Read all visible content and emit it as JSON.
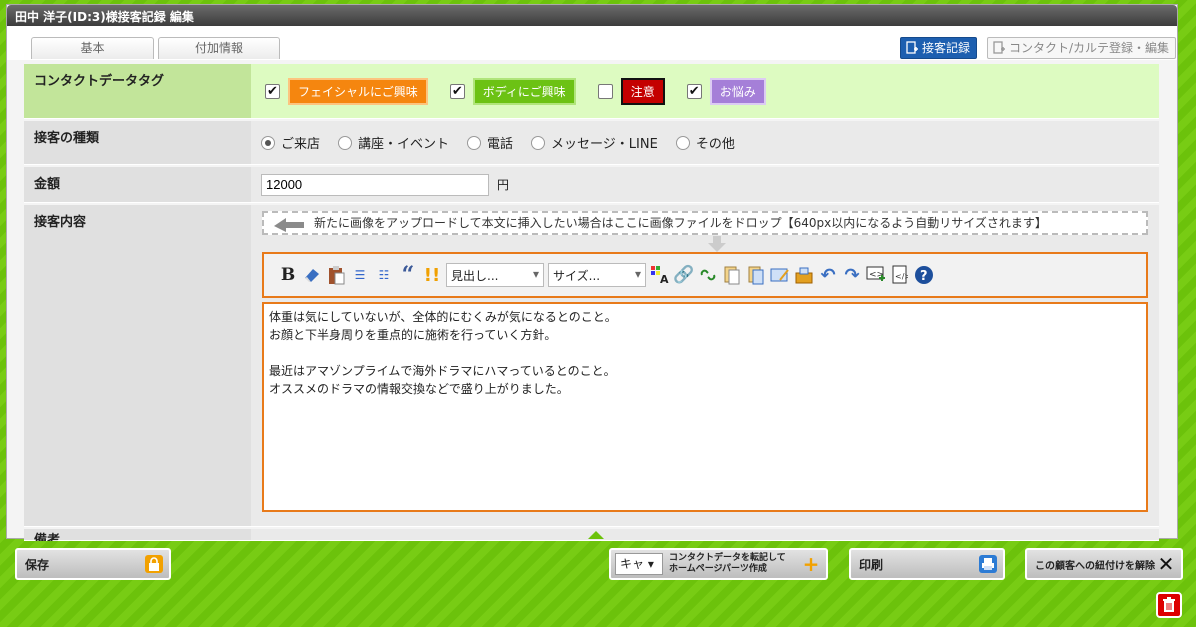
{
  "window": {
    "title": "田中 洋子(ID:3)様接客記録 編集"
  },
  "tabs": [
    {
      "label": "基本"
    },
    {
      "label": "付加情報"
    }
  ],
  "right_tabs": [
    {
      "label": "接客記録"
    },
    {
      "label": "コンタクト/カルテ登録・編集"
    }
  ],
  "tags": {
    "label": "コンタクトデータタグ",
    "items": [
      {
        "label": "フェイシャルにご興味",
        "checked": true,
        "color": "#f5860f"
      },
      {
        "label": "ボディにご興味",
        "checked": true,
        "color": "#6cc214"
      },
      {
        "label": "注意",
        "checked": false,
        "color": "#c40000"
      },
      {
        "label": "お悩み",
        "checked": true,
        "color": "#a57fd8"
      }
    ]
  },
  "type": {
    "label": "接客の種類",
    "options": [
      "ご来店",
      "講座・イベント",
      "電話",
      "メッセージ・LINE",
      "その他"
    ],
    "selected": "ご来店"
  },
  "amount": {
    "label": "金額",
    "value": "12000",
    "unit": "円"
  },
  "content": {
    "label": "接客内容",
    "dropzone": "新たに画像をアップロードして本文に挿入したい場合はここに画像ファイルをドロップ【640px以内になるよう自動リサイズされます】",
    "heading_select": "見出し...",
    "size_select": "サイズ...",
    "body": "体重は気にしていないが、全体的にむくみが気になるとのこと。\nお顔と下半身周りを重点的に施術を行っていく方針。\n\n最近はアマゾンプライムで海外ドラマにハマっているとのこと。\nオススメのドラマの情報交換などで盛り上がりました。"
  },
  "next_row_label": "備考",
  "footer": {
    "save": "保存",
    "carrier_select": "キャ",
    "transfer_line1": "コンタクトデータを転記して",
    "transfer_line2": "ホームページパーツ作成",
    "print": "印刷",
    "unlink": "この顧客への紐付けを解除"
  },
  "colors": {
    "accent": "#e87a1a",
    "bg_green": "#6cc20b",
    "active_tab": "#1d5fb0"
  }
}
